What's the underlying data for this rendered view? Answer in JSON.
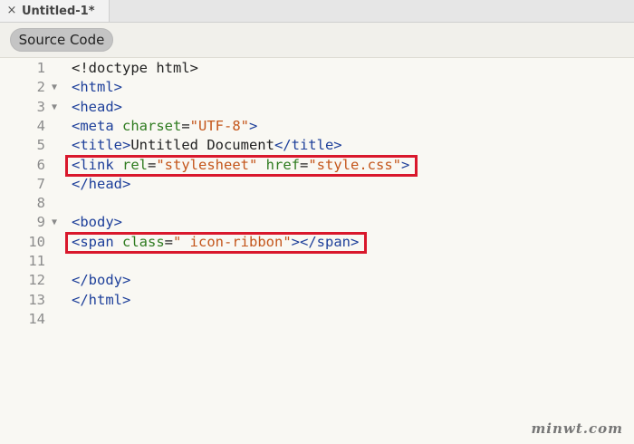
{
  "tab": {
    "close_glyph": "×",
    "title": "Untitled-1*"
  },
  "toolbar": {
    "source_code_label": "Source Code"
  },
  "editor": {
    "lines": [
      {
        "num": "1",
        "fold": false,
        "tokens": [
          {
            "t": "doc",
            "v": "<!doctype html>"
          }
        ]
      },
      {
        "num": "2",
        "fold": true,
        "tokens": [
          {
            "t": "tag",
            "v": "<html>"
          }
        ]
      },
      {
        "num": "3",
        "fold": true,
        "tokens": [
          {
            "t": "tag",
            "v": "<head>"
          }
        ]
      },
      {
        "num": "4",
        "fold": false,
        "tokens": [
          {
            "t": "tag",
            "v": "<meta "
          },
          {
            "t": "attr",
            "v": "charset"
          },
          {
            "t": "text",
            "v": "="
          },
          {
            "t": "str",
            "v": "\"UTF-8\""
          },
          {
            "t": "tag",
            "v": ">"
          }
        ]
      },
      {
        "num": "5",
        "fold": false,
        "tokens": [
          {
            "t": "tag",
            "v": "<title>"
          },
          {
            "t": "text",
            "v": "Untitled Document"
          },
          {
            "t": "tag",
            "v": "</title>"
          }
        ]
      },
      {
        "num": "6",
        "fold": false,
        "tokens": [
          {
            "t": "tag",
            "v": "<link "
          },
          {
            "t": "attr",
            "v": "rel"
          },
          {
            "t": "text",
            "v": "="
          },
          {
            "t": "str",
            "v": "\"stylesheet\""
          },
          {
            "t": "text",
            "v": " "
          },
          {
            "t": "attr",
            "v": "href"
          },
          {
            "t": "text",
            "v": "="
          },
          {
            "t": "str",
            "v": "\"style.css\""
          },
          {
            "t": "tag",
            "v": ">"
          }
        ]
      },
      {
        "num": "7",
        "fold": false,
        "tokens": [
          {
            "t": "tag",
            "v": "</head>"
          }
        ]
      },
      {
        "num": "8",
        "fold": false,
        "tokens": []
      },
      {
        "num": "9",
        "fold": true,
        "tokens": [
          {
            "t": "tag",
            "v": "<body>"
          }
        ]
      },
      {
        "num": "10",
        "fold": false,
        "tokens": [
          {
            "t": "tag",
            "v": "<span "
          },
          {
            "t": "attr",
            "v": "class"
          },
          {
            "t": "text",
            "v": "="
          },
          {
            "t": "str",
            "v": "\" icon-ribbon\""
          },
          {
            "t": "tag",
            "v": "></span>"
          }
        ]
      },
      {
        "num": "11",
        "fold": false,
        "tokens": []
      },
      {
        "num": "12",
        "fold": false,
        "tokens": [
          {
            "t": "tag",
            "v": "</body>"
          }
        ]
      },
      {
        "num": "13",
        "fold": false,
        "tokens": [
          {
            "t": "tag",
            "v": "</html>"
          }
        ]
      },
      {
        "num": "14",
        "fold": false,
        "tokens": []
      }
    ],
    "fold_glyph": "▼",
    "highlighted_lines": [
      "6",
      "10"
    ]
  },
  "colors": {
    "tag": "#1d3f9a",
    "attr": "#2e7b1f",
    "string": "#c4561b",
    "highlight": "#d9182c"
  },
  "watermark": {
    "text": "minwt.com"
  }
}
